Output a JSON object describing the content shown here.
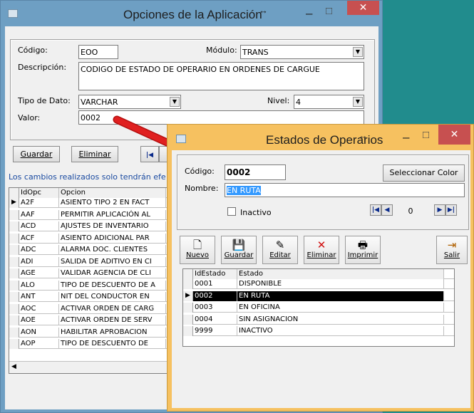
{
  "main_window": {
    "title": "Opciones de la Aplicación",
    "resize_glyph": "↔",
    "minimize_glyph": "–",
    "maximize_glyph": "□",
    "close_glyph": "✕",
    "codigo_label": "Código:",
    "codigo_value": "EOO",
    "modulo_label": "Módulo:",
    "modulo_value": "TRANS",
    "descripcion_label": "Descripción:",
    "descripcion_value": "CODIGO DE ESTADO DE OPERARIO EN ORDENES DE CARGUE",
    "tipo_label": "Tipo de Dato:",
    "tipo_value": "VARCHAR",
    "nivel_label": "Nivel:",
    "nivel_value": "4",
    "valor_label": "Valor:",
    "valor_value": "0002",
    "guardar_label": "Guardar",
    "eliminar_label": "Eliminar",
    "first_glyph": "|◀",
    "notice": "Los cambios realizados solo tendrán efe",
    "grid": {
      "columns": [
        "IdOpc",
        "Opcion"
      ],
      "rows": [
        [
          "A2F",
          "ASIENTO TIPO 2 EN FACT"
        ],
        [
          "AAF",
          "PERMITIR APLICACIÓN AL"
        ],
        [
          "ACD",
          "AJUSTES DE INVENTARIO"
        ],
        [
          "ACF",
          "ASIENTO ADICIONAL PAR"
        ],
        [
          "ADC",
          "ALARMA DOC. CLIENTES"
        ],
        [
          "ADI",
          "SALIDA DE ADITIVO EN CI"
        ],
        [
          "AGE",
          "VALIDAR AGENCIA DE CLI"
        ],
        [
          "ALO",
          "TIPO DE DESCUENTO DE A"
        ],
        [
          "ANT",
          "NIT DEL CONDUCTOR EN"
        ],
        [
          "AOC",
          "ACTIVAR ORDEN DE CARG"
        ],
        [
          "AOE",
          "ACTIVAR ORDEN DE SERV"
        ],
        [
          "AON",
          "HABILITAR APROBACION"
        ],
        [
          "AOP",
          "TIPO DE DESCUENTO DE"
        ]
      ],
      "current_marker": "▶",
      "scroll_left_glyph": "◀"
    }
  },
  "dialog": {
    "title": "Estados de Operarios",
    "resize_glyph": "↔",
    "minimize_glyph": "–",
    "maximize_glyph": "□",
    "close_glyph": "✕",
    "codigo_label": "Código:",
    "codigo_value": "0002",
    "nombre_label": "Nombre:",
    "nombre_value": "EN RUTA",
    "color_button": "Seleccionar Color",
    "inactivo_label": "Inactivo",
    "nav_first": "|◀",
    "nav_prev": "◀",
    "nav_counter": "0",
    "nav_next": "▶",
    "nav_last": "▶|",
    "toolbar": {
      "nuevo": "Nuevo",
      "guardar": "Guardar",
      "editar": "Editar",
      "eliminar": "Eliminar",
      "imprimir": "Imprimir",
      "salir": "Salir"
    },
    "grid": {
      "columns": [
        "IdEstado",
        "Estado"
      ],
      "rows": [
        [
          "0001",
          "DISPONIBLE"
        ],
        [
          "0002",
          "EN RUTA"
        ],
        [
          "0003",
          "EN OFICINA"
        ],
        [
          "0004",
          "SIN ASIGNACION"
        ],
        [
          "9999",
          "INACTIVO"
        ]
      ],
      "selected_index": 1,
      "current_marker": "▶"
    }
  },
  "colors": {
    "desktop": "#218c8d",
    "main_frame": "#6e9fc3",
    "dialog_frame": "#f6c160",
    "arrow": "#e02020",
    "close_button": "#c75050"
  }
}
